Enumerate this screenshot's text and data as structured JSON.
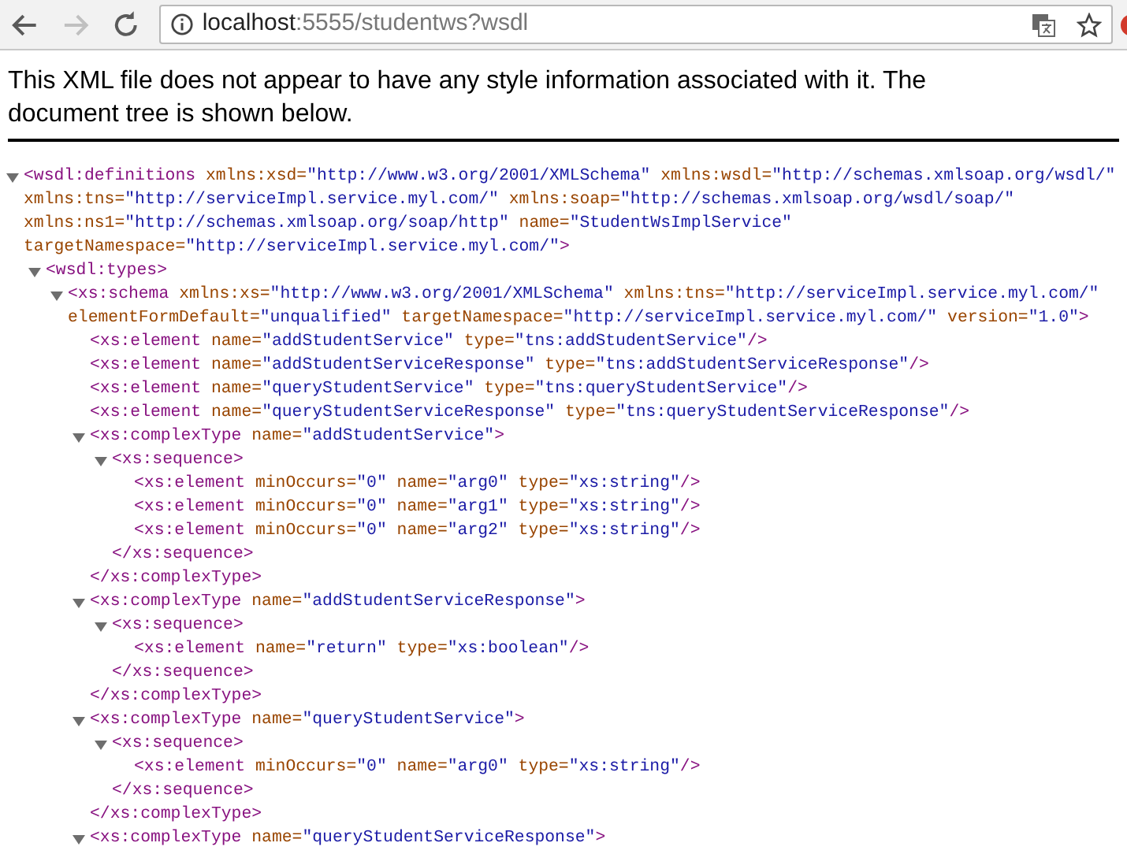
{
  "browser": {
    "back_disabled": false,
    "forward_disabled": true,
    "url_host": "localhost",
    "url_rest": ":5555/studentws?wsdl"
  },
  "notice": "This XML file does not appear to have any style information associated with it. The document tree is shown below.",
  "tree": {
    "tag": "<wsdl:definitions",
    "end": ">",
    "expanded": true,
    "attributes": [
      {
        "name": "xmlns:xsd=",
        "value": "\"http://www.w3.org/2001/XMLSchema\""
      },
      {
        "name": "xmlns:wsdl=",
        "value": "\"http://schemas.xmlsoap.org/wsdl/\""
      },
      {
        "name": "xmlns:tns=",
        "value": "\"http://serviceImpl.service.myl.com/\""
      },
      {
        "name": "xmlns:soap=",
        "value": "\"http://schemas.xmlsoap.org/wsdl/soap/\""
      },
      {
        "name": "xmlns:ns1=",
        "value": "\"http://schemas.xmlsoap.org/soap/http\""
      },
      {
        "name": "name=",
        "value": "\"StudentWsImplService\""
      },
      {
        "name": "targetNamespace=",
        "value": "\"http://serviceImpl.service.myl.com/\""
      }
    ],
    "children": [
      {
        "tag": "<wsdl:types",
        "end": ">",
        "expanded": true,
        "children": [
          {
            "tag": "<xs:schema",
            "end": ">",
            "expanded": true,
            "attributes": [
              {
                "name": "xmlns:xs=",
                "value": "\"http://www.w3.org/2001/XMLSchema\""
              },
              {
                "name": "xmlns:tns=",
                "value": "\"http://serviceImpl.service.myl.com/\""
              },
              {
                "name": "elementFormDefault=",
                "value": "\"unqualified\""
              },
              {
                "name": "targetNamespace=",
                "value": "\"http://serviceImpl.service.myl.com/\""
              },
              {
                "name": "version=",
                "value": "\"1.0\""
              }
            ],
            "children": [
              {
                "tag": "<xs:element",
                "end": "/>",
                "attributes": [
                  {
                    "name": "name=",
                    "value": "\"addStudentService\""
                  },
                  {
                    "name": "type=",
                    "value": "\"tns:addStudentService\""
                  }
                ]
              },
              {
                "tag": "<xs:element",
                "end": "/>",
                "attributes": [
                  {
                    "name": "name=",
                    "value": "\"addStudentServiceResponse\""
                  },
                  {
                    "name": "type=",
                    "value": "\"tns:addStudentServiceResponse\""
                  }
                ]
              },
              {
                "tag": "<xs:element",
                "end": "/>",
                "attributes": [
                  {
                    "name": "name=",
                    "value": "\"queryStudentService\""
                  },
                  {
                    "name": "type=",
                    "value": "\"tns:queryStudentService\""
                  }
                ]
              },
              {
                "tag": "<xs:element",
                "end": "/>",
                "attributes": [
                  {
                    "name": "name=",
                    "value": "\"queryStudentServiceResponse\""
                  },
                  {
                    "name": "type=",
                    "value": "\"tns:queryStudentServiceResponse\""
                  }
                ]
              },
              {
                "tag": "<xs:complexType",
                "end": ">",
                "expanded": true,
                "attributes": [
                  {
                    "name": "name=",
                    "value": "\"addStudentService\""
                  }
                ],
                "close": "</xs:complexType>",
                "children": [
                  {
                    "tag": "<xs:sequence",
                    "end": ">",
                    "expanded": true,
                    "close": "</xs:sequence>",
                    "children": [
                      {
                        "tag": "<xs:element",
                        "end": "/>",
                        "attributes": [
                          {
                            "name": "minOccurs=",
                            "value": "\"0\""
                          },
                          {
                            "name": "name=",
                            "value": "\"arg0\""
                          },
                          {
                            "name": "type=",
                            "value": "\"xs:string\""
                          }
                        ]
                      },
                      {
                        "tag": "<xs:element",
                        "end": "/>",
                        "attributes": [
                          {
                            "name": "minOccurs=",
                            "value": "\"0\""
                          },
                          {
                            "name": "name=",
                            "value": "\"arg1\""
                          },
                          {
                            "name": "type=",
                            "value": "\"xs:string\""
                          }
                        ]
                      },
                      {
                        "tag": "<xs:element",
                        "end": "/>",
                        "attributes": [
                          {
                            "name": "minOccurs=",
                            "value": "\"0\""
                          },
                          {
                            "name": "name=",
                            "value": "\"arg2\""
                          },
                          {
                            "name": "type=",
                            "value": "\"xs:string\""
                          }
                        ]
                      }
                    ]
                  }
                ]
              },
              {
                "tag": "<xs:complexType",
                "end": ">",
                "expanded": true,
                "attributes": [
                  {
                    "name": "name=",
                    "value": "\"addStudentServiceResponse\""
                  }
                ],
                "close": "</xs:complexType>",
                "children": [
                  {
                    "tag": "<xs:sequence",
                    "end": ">",
                    "expanded": true,
                    "close": "</xs:sequence>",
                    "children": [
                      {
                        "tag": "<xs:element",
                        "end": "/>",
                        "attributes": [
                          {
                            "name": "name=",
                            "value": "\"return\""
                          },
                          {
                            "name": "type=",
                            "value": "\"xs:boolean\""
                          }
                        ]
                      }
                    ]
                  }
                ]
              },
              {
                "tag": "<xs:complexType",
                "end": ">",
                "expanded": true,
                "attributes": [
                  {
                    "name": "name=",
                    "value": "\"queryStudentService\""
                  }
                ],
                "close": "</xs:complexType>",
                "children": [
                  {
                    "tag": "<xs:sequence",
                    "end": ">",
                    "expanded": true,
                    "close": "</xs:sequence>",
                    "children": [
                      {
                        "tag": "<xs:element",
                        "end": "/>",
                        "attributes": [
                          {
                            "name": "minOccurs=",
                            "value": "\"0\""
                          },
                          {
                            "name": "name=",
                            "value": "\"arg0\""
                          },
                          {
                            "name": "type=",
                            "value": "\"xs:string\""
                          }
                        ]
                      }
                    ]
                  }
                ]
              },
              {
                "tag": "<xs:complexType",
                "end": ">",
                "expanded": true,
                "attributes": [
                  {
                    "name": "name=",
                    "value": "\"queryStudentServiceResponse\""
                  }
                ]
              }
            ]
          }
        ]
      }
    ]
  }
}
